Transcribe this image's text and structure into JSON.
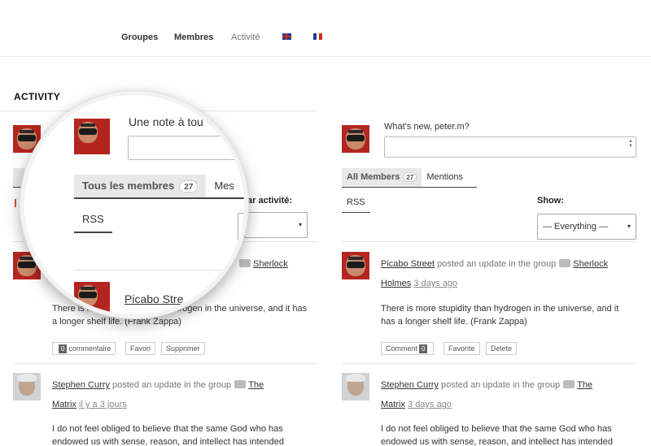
{
  "nav": {
    "items": [
      "Groupes",
      "Membres",
      "Activité"
    ],
    "flags": [
      "uk-flag",
      "france-flag"
    ]
  },
  "page": {
    "title": "ACTIVITY"
  },
  "left": {
    "show_label": "ar activité:",
    "select_arrow": "▾",
    "activities": [
      {
        "content": "There is more stupidity than hydrogen in the universe, and it has a longer shelf life. (Frank Zappa)",
        "group": "Sherlock",
        "buttons": {
          "comment_count": "0",
          "comment_label": "commentaire",
          "favorite": "Favori",
          "delete": "Supprimer"
        }
      },
      {
        "author": "Stephen Curry",
        "action": "posted an update in the group",
        "group_line1": "The",
        "group_line2": "Matrix",
        "time": "il y a 3 jours",
        "content": "I do not feel obliged to believe that the same God who has endowed us with sense, reason, and intellect has intended"
      }
    ]
  },
  "magnifier": {
    "note_prompt": "Une note à tou",
    "tab_all": "Tous les membres",
    "tab_all_count": "27",
    "tab_next": "Mes",
    "rss": "RSS",
    "author": "Picabo Stre"
  },
  "right": {
    "whats_new": "What's new, peter.m?",
    "tabs": {
      "all": "All Members",
      "count": "27",
      "mentions": "Mentions"
    },
    "rss": "RSS",
    "show_label": "Show:",
    "select_value": "— Everything —",
    "select_arrow": "▾",
    "activities": [
      {
        "author": "Picabo Street",
        "action": "posted an update in the group",
        "group": "Sherlock",
        "group_line2": "Holmes",
        "time": "3 days ago",
        "content": "There is more stupidity than hydrogen in the universe, and it has a longer shelf life. (Frank Zappa)",
        "buttons": {
          "comment_label": "Comment",
          "comment_count": "0",
          "favorite": "Favorite",
          "delete": "Delete"
        }
      },
      {
        "author": "Stephen Curry",
        "action": "posted an update in the group",
        "group_line1": "The",
        "group_line2": "Matrix",
        "time": "3 days ago",
        "content": "I do not feel obliged to believe that the same God who has endowed us with sense, reason, and intellect has intended"
      }
    ]
  },
  "colors": {
    "accent_red": "#b42520",
    "tab_bg": "#e8e8e8",
    "divider": "#e6e6e6"
  }
}
